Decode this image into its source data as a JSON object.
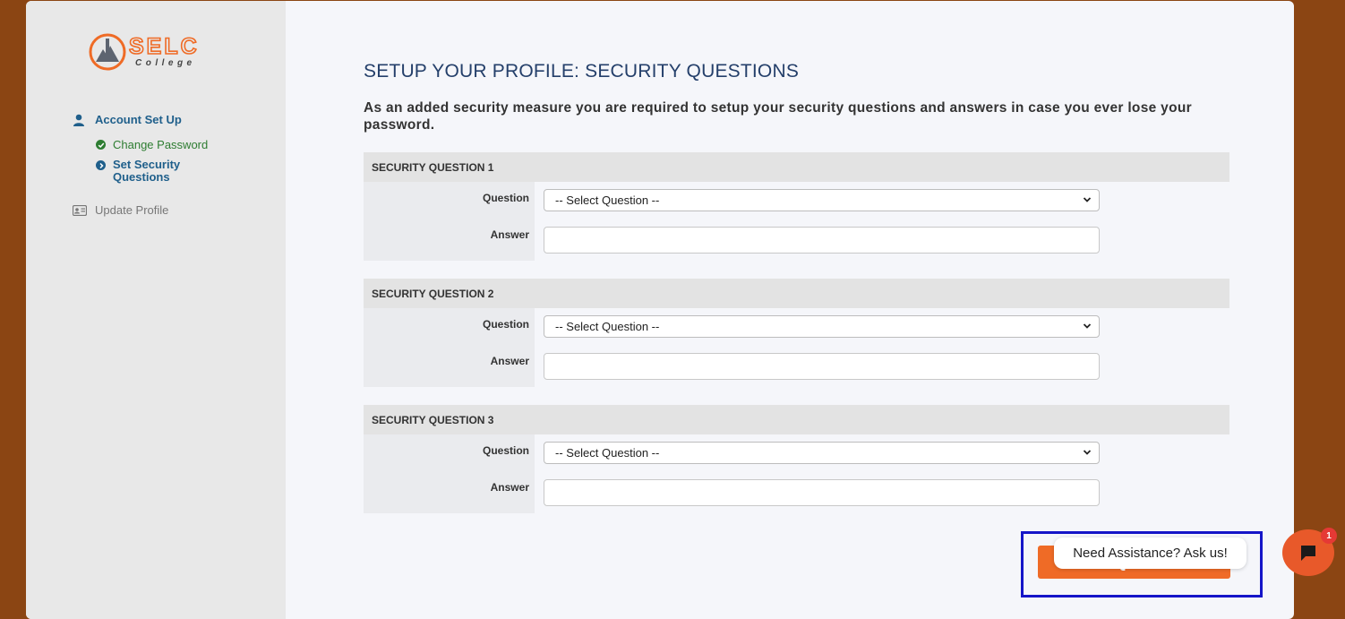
{
  "brand": {
    "logo_text": "SELC",
    "logo_subtext": "College"
  },
  "sidebar": {
    "main_item": {
      "label": "Account Set Up",
      "icon": "user-icon"
    },
    "sub_items": [
      {
        "label": "Change Password",
        "icon": "check-circle-icon",
        "status": "done"
      },
      {
        "label_line1": "Set Security",
        "label_line2": "Questions",
        "icon": "chevron-circle-icon",
        "status": "active"
      }
    ],
    "update_item": {
      "label": "Update Profile",
      "icon": "id-card-icon"
    }
  },
  "main": {
    "title": "SETUP YOUR PROFILE: SECURITY QUESTIONS",
    "intro": "As an added security measure you are required to setup your security questions and answers in case you ever lose your password.",
    "sections": [
      {
        "heading": "SECURITY QUESTION 1",
        "question_label": "Question",
        "answer_label": "Answer",
        "select_value": "-- Select Question --",
        "answer_value": ""
      },
      {
        "heading": "SECURITY QUESTION 2",
        "question_label": "Question",
        "answer_label": "Answer",
        "select_value": "-- Select Question --",
        "answer_value": ""
      },
      {
        "heading": "SECURITY QUESTION 3",
        "question_label": "Question",
        "answer_label": "Answer",
        "select_value": "-- Select Question --",
        "answer_value": ""
      }
    ],
    "save_button": "Save Questions"
  },
  "chat": {
    "prompt": "Need Assistance? Ask us!",
    "badge_count": "1",
    "icon": "chat-bubble-icon"
  },
  "colors": {
    "background": "#8b4513",
    "accent": "#ef6b26",
    "nav_blue": "#1f5f8b",
    "success": "#2e7d32",
    "highlight_border": "#1515c8"
  }
}
